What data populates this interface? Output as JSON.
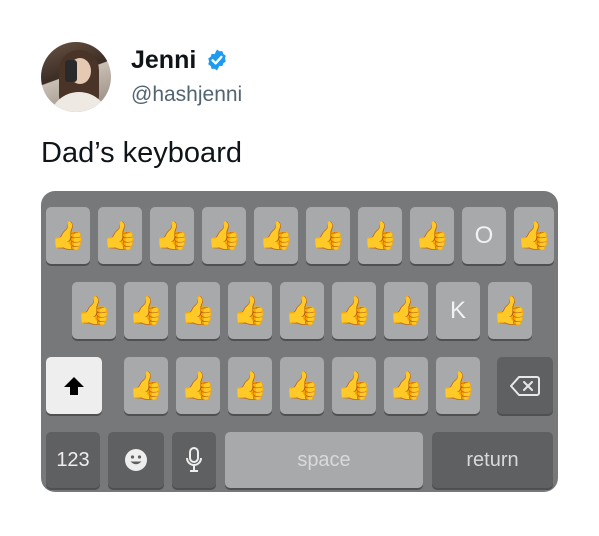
{
  "tweet": {
    "author_name": "Jenni",
    "author_handle": "@hashjenni",
    "text": "Dad’s keyboard",
    "verified_color": "#1d9bf0"
  },
  "keyboard": {
    "row1": [
      "👍",
      "👍",
      "👍",
      "👍",
      "👍",
      "👍",
      "👍",
      "👍",
      "O",
      "👍"
    ],
    "row2": [
      "👍",
      "👍",
      "👍",
      "👍",
      "👍",
      "👍",
      "👍",
      "K",
      "👍"
    ],
    "row3": [
      "👍",
      "👍",
      "👍",
      "👍",
      "👍",
      "👍",
      "👍"
    ],
    "number_key": "123",
    "space_key": "space",
    "return_key": "return",
    "icons": {
      "shift": "shift-arrow-icon",
      "delete": "backspace-icon",
      "emoji": "emoji-icon",
      "mic": "microphone-icon"
    }
  }
}
